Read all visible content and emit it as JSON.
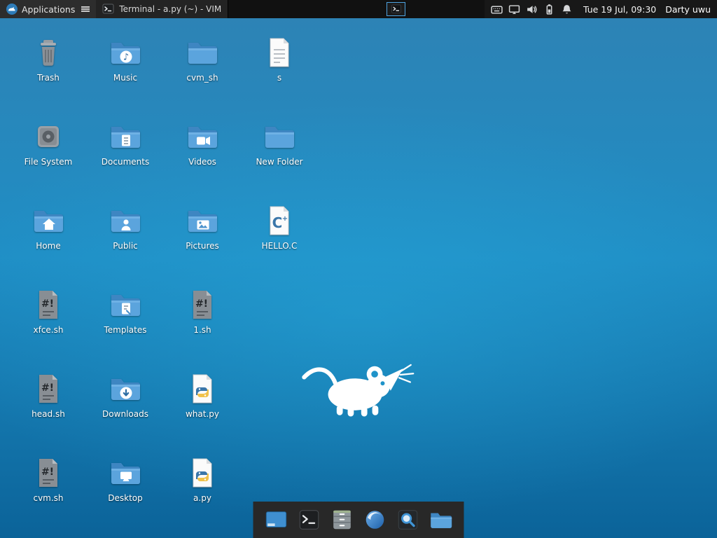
{
  "colors": {
    "desktop_top": "#2e82b4",
    "desktop_mid": "#1f8ec5",
    "desktop_bottom": "#0b6399",
    "panel_bg": "#111111",
    "dock_bg": "#282828",
    "folder_blue": "#5ba4dd",
    "accent_blue": "#4ea3e0"
  },
  "panel": {
    "applications_label": "Applications",
    "menu_icon": "applications-menu-icon",
    "task_button": {
      "icon": "terminal-icon",
      "title": "Terminal - a.py (~) - VIM"
    },
    "launcher_icon": "terminal-icon",
    "tray_icons": [
      "keyboard-icon",
      "display-icon",
      "volume-icon",
      "battery-icon",
      "notifications-icon"
    ],
    "clock": "Tue 19 Jul, 09:30",
    "username": "Darty uwu"
  },
  "desktop": {
    "logo": "xfce-mouse-logo",
    "icons": [
      {
        "label": "Trash",
        "icon": "trash-icon",
        "col": 0,
        "row": 0
      },
      {
        "label": "Music",
        "icon": "folder-music-icon",
        "col": 1,
        "row": 0
      },
      {
        "label": "cvm_sh",
        "icon": "folder-icon",
        "col": 2,
        "row": 0
      },
      {
        "label": "s",
        "icon": "file-icon",
        "col": 3,
        "row": 0
      },
      {
        "label": "File System",
        "icon": "filesystem-icon",
        "col": 0,
        "row": 1
      },
      {
        "label": "Documents",
        "icon": "folder-documents-icon",
        "col": 1,
        "row": 1
      },
      {
        "label": "Videos",
        "icon": "folder-videos-icon",
        "col": 2,
        "row": 1
      },
      {
        "label": "New Folder",
        "icon": "folder-icon",
        "col": 3,
        "row": 1
      },
      {
        "label": "Home",
        "icon": "folder-home-icon",
        "col": 0,
        "row": 2
      },
      {
        "label": "Public",
        "icon": "folder-public-icon",
        "col": 1,
        "row": 2
      },
      {
        "label": "Pictures",
        "icon": "folder-pictures-icon",
        "col": 2,
        "row": 2
      },
      {
        "label": "HELLO.C",
        "icon": "c-source-icon",
        "col": 3,
        "row": 2
      },
      {
        "label": "xfce.sh",
        "icon": "shell-script-icon",
        "col": 0,
        "row": 3
      },
      {
        "label": "Templates",
        "icon": "folder-templates-icon",
        "col": 1,
        "row": 3
      },
      {
        "label": "1.sh",
        "icon": "shell-script-icon",
        "col": 2,
        "row": 3
      },
      {
        "label": "head.sh",
        "icon": "shell-script-icon",
        "col": 0,
        "row": 4
      },
      {
        "label": "Downloads",
        "icon": "folder-downloads-icon",
        "col": 1,
        "row": 4
      },
      {
        "label": "what.py",
        "icon": "python-file-icon",
        "col": 2,
        "row": 4
      },
      {
        "label": "cvm.sh",
        "icon": "shell-script-icon",
        "col": 0,
        "row": 5
      },
      {
        "label": "Desktop",
        "icon": "folder-desktop-icon",
        "col": 1,
        "row": 5
      },
      {
        "label": "a.py",
        "icon": "python-file-icon",
        "col": 2,
        "row": 5
      }
    ]
  },
  "dock": {
    "items": [
      {
        "name": "show-desktop",
        "icon": "show-desktop-icon"
      },
      {
        "name": "terminal",
        "icon": "terminal-app-icon"
      },
      {
        "name": "file-manager",
        "icon": "file-manager-icon"
      },
      {
        "name": "web-browser",
        "icon": "web-browser-icon"
      },
      {
        "name": "app-finder",
        "icon": "app-finder-icon"
      },
      {
        "name": "files",
        "icon": "folder-app-icon"
      }
    ]
  }
}
